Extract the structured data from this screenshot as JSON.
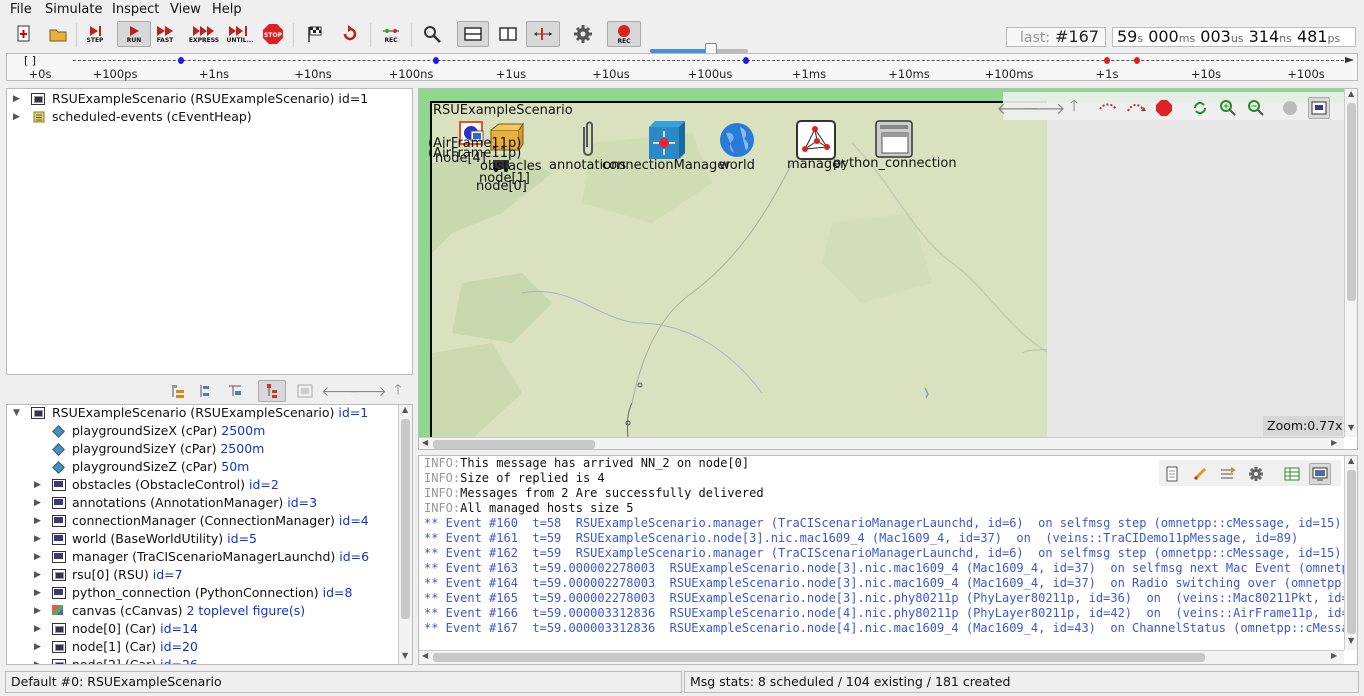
{
  "menu": [
    "File",
    "Simulate",
    "Inspect",
    "View",
    "Help"
  ],
  "toolbar": {
    "step": "STEP",
    "run": "RUN",
    "fast": "FAST",
    "express": "EXPRESS",
    "until": "UNTIL...",
    "stop": "STOP",
    "rec": "REC",
    "rec2": "REC"
  },
  "status_top": {
    "last_label": "last:",
    "last_event": "#167",
    "time_parts": [
      {
        "v": "59",
        "u": "s"
      },
      {
        "v": "000",
        "u": "ms"
      },
      {
        "v": "003",
        "u": "us"
      },
      {
        "v": "314",
        "u": "ns"
      },
      {
        "v": "481",
        "u": "ps"
      }
    ]
  },
  "timeline": {
    "bracket": "[   ]",
    "ticks": [
      "+0s",
      "+100ps",
      "+1ns",
      "+10ns",
      "+100ns",
      "+1us",
      "+10us",
      "+100us",
      "+1ms",
      "+10ms",
      "+100ms",
      "+1s",
      "+10s",
      "+100s"
    ],
    "marker_colors": {
      "blue": "#1a1aee",
      "red": "#e02020"
    }
  },
  "object_tree": [
    {
      "label": "RSUExampleScenario (RSUExampleScenario) id=1",
      "icon": "network-icon"
    },
    {
      "label": "scheduled-events (cEventHeap)",
      "icon": "event-heap-icon"
    }
  ],
  "inspector_tree": {
    "root": {
      "name": "RSUExampleScenario (RSUExampleScenario)",
      "id": "id=1"
    },
    "items": [
      {
        "name": "playgroundSizeX (cPar)",
        "val": "2500m",
        "kind": "param"
      },
      {
        "name": "playgroundSizeY (cPar)",
        "val": "2500m",
        "kind": "param"
      },
      {
        "name": "playgroundSizeZ (cPar)",
        "val": "50m",
        "kind": "param"
      },
      {
        "name": "obstacles (ObstacleControl)",
        "val": "id=2",
        "kind": "module"
      },
      {
        "name": "annotations (AnnotationManager)",
        "val": "id=3",
        "kind": "module"
      },
      {
        "name": "connectionManager (ConnectionManager)",
        "val": "id=4",
        "kind": "module"
      },
      {
        "name": "world (BaseWorldUtility)",
        "val": "id=5",
        "kind": "module"
      },
      {
        "name": "manager (TraCIScenarioManagerLaunchd)",
        "val": "id=6",
        "kind": "module"
      },
      {
        "name": "rsu[0] (RSU)",
        "val": "id=7",
        "kind": "compound"
      },
      {
        "name": "python_connection (PythonConnection)",
        "val": "id=8",
        "kind": "module"
      },
      {
        "name": "canvas (cCanvas)",
        "val": "2 toplevel figure(s)",
        "kind": "canvas"
      },
      {
        "name": "node[0] (Car)",
        "val": "id=14",
        "kind": "compound"
      },
      {
        "name": "node[1] (Car)",
        "val": "id=20",
        "kind": "compound"
      },
      {
        "name": "node[2] (Car)",
        "val": "id=26",
        "kind": "compound"
      }
    ]
  },
  "canvas": {
    "network_title": "RSUExampleScenario",
    "labels": {
      "airframe1": "(AirFrame11p)",
      "airframe2": "(AirFrame11p)",
      "node4": "node[4]",
      "obstacles": "obstacles",
      "node1": "node[1]",
      "node0": "node[0]",
      "annotations": "annotations",
      "connection_manager": "connectionManager",
      "world": "world",
      "manager": "manager",
      "python_connection": "python_connection"
    },
    "zoom": "Zoom:0.77x",
    "map_bg": "#d8e0bd",
    "frame_color": "#8ed88e"
  },
  "log": {
    "lines": [
      {
        "type": "info",
        "pre": "INFO:",
        "text": "This message has arrived NN_2 on node[0]"
      },
      {
        "type": "info",
        "pre": "INFO:",
        "text": "Size of replied is 4"
      },
      {
        "type": "info",
        "pre": "INFO:",
        "text": "Messages from 2 Are successfully delivered"
      },
      {
        "type": "info",
        "pre": "INFO:",
        "text": "All managed hosts size 5"
      },
      {
        "type": "event",
        "text": "** Event #160  t=58  RSUExampleScenario.manager (TraCIScenarioManagerLaunchd, id=6)  on selfmsg step (omnetpp::cMessage, id=15)"
      },
      {
        "type": "event",
        "text": "** Event #161  t=59  RSUExampleScenario.node[3].nic.mac1609_4 (Mac1609_4, id=37)  on  (veins::TraCIDemo11pMessage, id=89)"
      },
      {
        "type": "event",
        "text": "** Event #162  t=59  RSUExampleScenario.manager (TraCIScenarioManagerLaunchd, id=6)  on selfmsg step (omnetpp::cMessage, id=15)"
      },
      {
        "type": "event",
        "text": "** Event #163  t=59.000002278003  RSUExampleScenario.node[3].nic.mac1609_4 (Mac1609_4, id=37)  on selfmsg next Mac Event (omnetp"
      },
      {
        "type": "event",
        "text": "** Event #164  t=59.000002278003  RSUExampleScenario.node[3].nic.mac1609_4 (Mac1609_4, id=37)  on Radio switching over (omnetpp"
      },
      {
        "type": "event",
        "text": "** Event #165  t=59.000002278003  RSUExampleScenario.node[3].nic.phy80211p (PhyLayer80211p, id=36)  on  (veins::Mac80211Pkt, id="
      },
      {
        "type": "event",
        "text": "** Event #166  t=59.000003312836  RSUExampleScenario.node[4].nic.phy80211p (PhyLayer80211p, id=42)  on  (veins::AirFrame11p, id="
      },
      {
        "type": "event",
        "text": "** Event #167  t=59.000003312836  RSUExampleScenario.node[4].nic.mac1609_4 (Mac1609_4, id=43)  on ChannelStatus (omnetpp::cMessa"
      }
    ]
  },
  "statusbar": {
    "left": "Default #0: RSUExampleScenario",
    "right": "Msg stats: 8 scheduled / 104 existing / 181 created"
  }
}
